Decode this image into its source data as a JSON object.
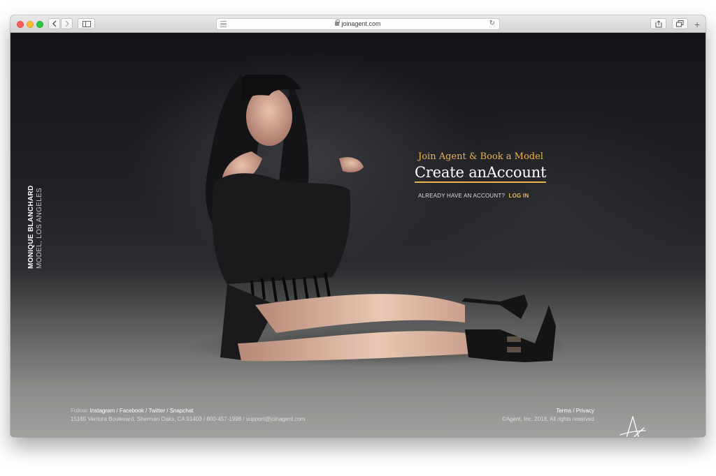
{
  "browser": {
    "url": "joinagent.com",
    "icons": {
      "back": "chevron-left-icon",
      "forward": "chevron-right-icon",
      "sidebar": "sidebar-icon",
      "share": "share-icon",
      "tabs": "tabs-icon",
      "reload": "reload-icon",
      "new_tab": "plus-icon"
    }
  },
  "page": {
    "side_label": {
      "name": "MONIQUE BLANCHARD",
      "subtitle": "MODEL, LOS ANGELES"
    },
    "cta": {
      "tagline": "Join Agent & Book a Model",
      "heading": "Create anAccount",
      "login_prompt": "ALREADY HAVE AN ACCOUNT?",
      "login_link": "LOG IN"
    },
    "footer": {
      "follow_label": "Follow:",
      "social": "Instagram / Facebook / Twitter / Snapchat",
      "address": "15165 Ventura Boulevard, Sherman Oaks, CA 91403 / 800-457-1998 / support@joinagent.com",
      "terms": "Terms / Privacy",
      "copyright": "©Agent, Inc. 2018, All rights reserved"
    }
  },
  "colors": {
    "accent": "#f0b34a",
    "background_dark": "#1d1e21",
    "floor": "#8b8c89",
    "text_light": "#ffffff"
  }
}
